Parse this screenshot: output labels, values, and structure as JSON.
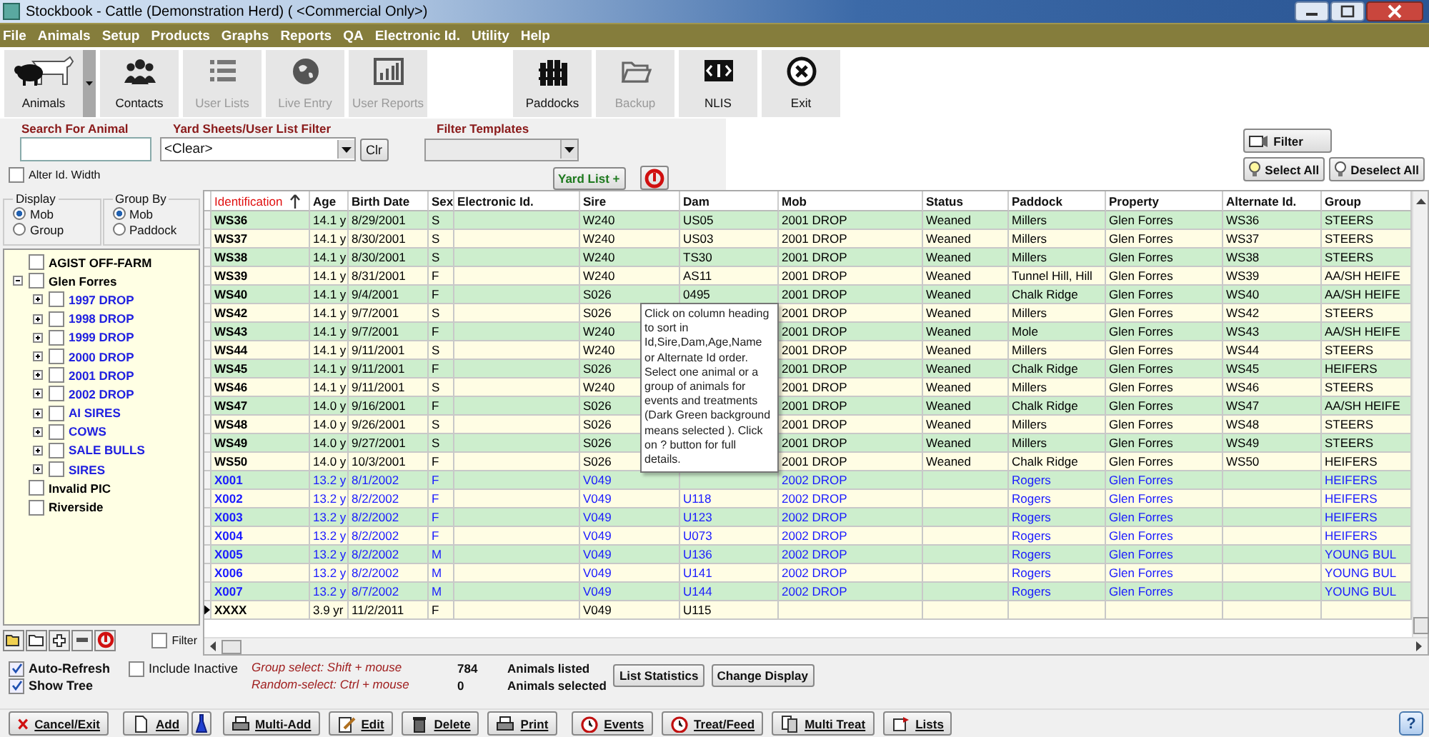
{
  "window": {
    "title": "Stockbook - Cattle (Demonstration Herd) ( <Commercial Only>)"
  },
  "menu": [
    "File",
    "Animals",
    "Setup",
    "Products",
    "Graphs",
    "Reports",
    "QA",
    "Electronic Id.",
    "Utility",
    "Help"
  ],
  "toolbar_left": [
    {
      "label": "Animals",
      "disabled": false
    },
    {
      "label": "Contacts",
      "disabled": false
    },
    {
      "label": "User Lists",
      "disabled": true
    },
    {
      "label": "Live Entry",
      "disabled": true
    },
    {
      "label": "User Reports",
      "disabled": true
    }
  ],
  "toolbar_right": [
    {
      "label": "Paddocks",
      "disabled": false
    },
    {
      "label": "Backup",
      "disabled": true
    },
    {
      "label": "NLIS",
      "disabled": false
    },
    {
      "label": "Exit",
      "disabled": false
    }
  ],
  "filters": {
    "search_label": "Search For Animal",
    "yard_label": "Yard Sheets/User List Filter",
    "yard_value": "<Clear>",
    "clear_button": "Clr",
    "templates_label": "Filter Templates",
    "alter_width": {
      "label": "Alter Id. Width",
      "checked": false
    },
    "yard_list_button": "Yard List +"
  },
  "right_buttons": {
    "filter": "Filter",
    "select_all": "Select All",
    "deselect_all": "Deselect All"
  },
  "display": {
    "title": "Display",
    "options": [
      {
        "label": "Mob",
        "selected": true
      },
      {
        "label": "Group",
        "selected": false
      }
    ]
  },
  "group_by": {
    "title": "Group By",
    "options": [
      {
        "label": "Mob",
        "selected": true
      },
      {
        "label": "Paddock",
        "selected": false
      }
    ]
  },
  "tree": [
    {
      "label": "AGIST OFF-FARM",
      "checked": false,
      "color": "#000000"
    },
    {
      "label": "Glen Forres",
      "checked": false,
      "color": "#000000",
      "expanded": true,
      "children": [
        {
          "label": "1997 DROP",
          "checked": false,
          "color": "#2020e0",
          "expanded": false
        },
        {
          "label": "1998 DROP",
          "checked": false,
          "color": "#2020e0",
          "expanded": false
        },
        {
          "label": "1999 DROP",
          "checked": false,
          "color": "#2020e0",
          "expanded": false
        },
        {
          "label": "2000 DROP",
          "checked": false,
          "color": "#2020e0",
          "expanded": false
        },
        {
          "label": "2001 DROP",
          "checked": false,
          "color": "#2020e0",
          "expanded": false
        },
        {
          "label": "2002 DROP",
          "checked": false,
          "color": "#2020e0",
          "expanded": false
        },
        {
          "label": "AI SIRES",
          "checked": false,
          "color": "#2020e0",
          "expanded": false
        },
        {
          "label": "COWS",
          "checked": false,
          "color": "#2020e0",
          "expanded": false
        },
        {
          "label": "SALE BULLS",
          "checked": false,
          "color": "#2020e0",
          "expanded": false
        },
        {
          "label": "SIRES",
          "checked": false,
          "color": "#2020e0",
          "expanded": false
        }
      ]
    },
    {
      "label": "Invalid PIC",
      "checked": false,
      "color": "#000000"
    },
    {
      "label": "Riverside",
      "checked": false,
      "color": "#000000"
    }
  ],
  "tree_filter": {
    "label": "Filter",
    "checked": false
  },
  "table": {
    "columns": [
      {
        "label": "Identification",
        "sorted": true
      },
      {
        "label": "Age",
        "sorted": false
      },
      {
        "label": "Birth Date",
        "sorted": false
      },
      {
        "label": "Sex",
        "sorted": false
      },
      {
        "label": "Electronic Id.",
        "sorted": false
      },
      {
        "label": "Sire",
        "sorted": false
      },
      {
        "label": "Dam",
        "sorted": false
      },
      {
        "label": "Mob",
        "sorted": false
      },
      {
        "label": "Status",
        "sorted": false
      },
      {
        "label": "Paddock",
        "sorted": false
      },
      {
        "label": "Property",
        "sorted": false
      },
      {
        "label": "Alternate Id.",
        "sorted": false
      },
      {
        "label": "Group",
        "sorted": false
      }
    ],
    "rows": [
      {
        "current": false,
        "color": "#000000",
        "cells": [
          "WS36",
          "14.1 y",
          "8/29/2001",
          "S",
          null,
          "W240",
          "US05",
          "2001 DROP",
          "Weaned",
          "Millers",
          "Glen Forres",
          "WS36",
          "STEERS"
        ]
      },
      {
        "current": false,
        "color": "#000000",
        "cells": [
          "WS37",
          "14.1 y",
          "8/30/2001",
          "S",
          null,
          "W240",
          "US03",
          "2001 DROP",
          "Weaned",
          "Millers",
          "Glen Forres",
          "WS37",
          "STEERS"
        ]
      },
      {
        "current": false,
        "color": "#000000",
        "cells": [
          "WS38",
          "14.1 y",
          "8/30/2001",
          "S",
          null,
          "W240",
          "TS30",
          "2001 DROP",
          "Weaned",
          "Millers",
          "Glen Forres",
          "WS38",
          "STEERS"
        ]
      },
      {
        "current": false,
        "color": "#000000",
        "cells": [
          "WS39",
          "14.1 y",
          "8/31/2001",
          "F",
          null,
          "W240",
          "AS11",
          "2001 DROP",
          "Weaned",
          "Tunnel Hill, Hill",
          "Glen Forres",
          "WS39",
          "AA/SH HEIFE"
        ]
      },
      {
        "current": false,
        "color": "#000000",
        "cells": [
          "WS40",
          "14.1 y",
          "9/4/2001",
          "F",
          null,
          "S026",
          "0495",
          "2001 DROP",
          "Weaned",
          "Chalk Ridge",
          "Glen Forres",
          "WS40",
          "AA/SH HEIFE"
        ]
      },
      {
        "current": false,
        "color": "#000000",
        "cells": [
          "WS42",
          "14.1 y",
          "9/7/2001",
          "S",
          null,
          "S026",
          null,
          "2001 DROP",
          "Weaned",
          "Millers",
          "Glen Forres",
          "WS42",
          "STEERS"
        ]
      },
      {
        "current": false,
        "color": "#000000",
        "cells": [
          "WS43",
          "14.1 y",
          "9/7/2001",
          "F",
          null,
          "W240",
          null,
          "2001 DROP",
          "Weaned",
          "Mole",
          "Glen Forres",
          "WS43",
          "AA/SH HEIFE"
        ]
      },
      {
        "current": false,
        "color": "#000000",
        "cells": [
          "WS44",
          "14.1 y",
          "9/11/2001",
          "S",
          null,
          "W240",
          null,
          "2001 DROP",
          "Weaned",
          "Millers",
          "Glen Forres",
          "WS44",
          "STEERS"
        ]
      },
      {
        "current": false,
        "color": "#000000",
        "cells": [
          "WS45",
          "14.1 y",
          "9/11/2001",
          "F",
          null,
          "S026",
          null,
          "2001 DROP",
          "Weaned",
          "Chalk Ridge",
          "Glen Forres",
          "WS45",
          "HEIFERS"
        ]
      },
      {
        "current": false,
        "color": "#000000",
        "cells": [
          "WS46",
          "14.1 y",
          "9/11/2001",
          "S",
          null,
          "W240",
          null,
          "2001 DROP",
          "Weaned",
          "Millers",
          "Glen Forres",
          "WS46",
          "STEERS"
        ]
      },
      {
        "current": false,
        "color": "#000000",
        "cells": [
          "WS47",
          "14.0 y",
          "9/16/2001",
          "F",
          null,
          "S026",
          null,
          "2001 DROP",
          "Weaned",
          "Chalk Ridge",
          "Glen Forres",
          "WS47",
          "AA/SH HEIFE"
        ]
      },
      {
        "current": false,
        "color": "#000000",
        "cells": [
          "WS48",
          "14.0 y",
          "9/26/2001",
          "S",
          null,
          "S026",
          null,
          "2001 DROP",
          "Weaned",
          "Millers",
          "Glen Forres",
          "WS48",
          "STEERS"
        ]
      },
      {
        "current": false,
        "color": "#000000",
        "cells": [
          "WS49",
          "14.0 y",
          "9/27/2001",
          "S",
          null,
          "S026",
          null,
          "2001 DROP",
          "Weaned",
          "Millers",
          "Glen Forres",
          "WS49",
          "STEERS"
        ]
      },
      {
        "current": false,
        "color": "#000000",
        "cells": [
          "WS50",
          "14.0 y",
          "10/3/2001",
          "F",
          null,
          "S026",
          null,
          "2001 DROP",
          "Weaned",
          "Chalk Ridge",
          "Glen Forres",
          "WS50",
          "HEIFERS"
        ]
      },
      {
        "current": false,
        "color": "#1a1aff",
        "cells": [
          "X001",
          "13.2 y",
          "8/1/2002",
          "F",
          null,
          "V049",
          null,
          "2002 DROP",
          null,
          "Rogers",
          "Glen Forres",
          null,
          "HEIFERS"
        ]
      },
      {
        "current": false,
        "color": "#1a1aff",
        "cells": [
          "X002",
          "13.2 y",
          "8/2/2002",
          "F",
          null,
          "V049",
          "U118",
          "2002 DROP",
          null,
          "Rogers",
          "Glen Forres",
          null,
          "HEIFERS"
        ]
      },
      {
        "current": false,
        "color": "#1a1aff",
        "cells": [
          "X003",
          "13.2 y",
          "8/2/2002",
          "F",
          null,
          "V049",
          "U123",
          "2002 DROP",
          null,
          "Rogers",
          "Glen Forres",
          null,
          "HEIFERS"
        ]
      },
      {
        "current": false,
        "color": "#1a1aff",
        "cells": [
          "X004",
          "13.2 y",
          "8/2/2002",
          "F",
          null,
          "V049",
          "U073",
          "2002 DROP",
          null,
          "Rogers",
          "Glen Forres",
          null,
          "HEIFERS"
        ]
      },
      {
        "current": false,
        "color": "#1a1aff",
        "cells": [
          "X005",
          "13.2 y",
          "8/2/2002",
          "M",
          null,
          "V049",
          "U136",
          "2002 DROP",
          null,
          "Rogers",
          "Glen Forres",
          null,
          "YOUNG BUL"
        ]
      },
      {
        "current": false,
        "color": "#1a1aff",
        "cells": [
          "X006",
          "13.2 y",
          "8/2/2002",
          "M",
          null,
          "V049",
          "U141",
          "2002 DROP",
          null,
          "Rogers",
          "Glen Forres",
          null,
          "YOUNG BUL"
        ]
      },
      {
        "current": false,
        "color": "#1a1aff",
        "cells": [
          "X007",
          "13.2 y",
          "8/7/2002",
          "M",
          null,
          "V049",
          "U144",
          "2002 DROP",
          null,
          "Rogers",
          "Glen Forres",
          null,
          "YOUNG BUL"
        ]
      },
      {
        "current": true,
        "color": "#000000",
        "cells": [
          "XXXX",
          "3.9 yr",
          "11/2/2011",
          "F",
          null,
          "V049",
          "U115",
          null,
          null,
          null,
          null,
          null,
          null
        ]
      }
    ]
  },
  "tooltip": "Click on column heading to sort in Id,Sire,Dam,Age,Name or Alternate Id order. Select one animal or a group of animals for events and treatments (Dark Green background means selected ). Click on ? button for full details.",
  "status": {
    "checks": [
      {
        "label": "Auto-Refresh",
        "checked": true
      },
      {
        "label": "Show Tree",
        "checked": true
      },
      {
        "label": "Include Inactive",
        "checked": false
      }
    ],
    "hints": [
      "Group select: Shift + mouse",
      "Random-select: Ctrl + mouse"
    ],
    "counts": [
      {
        "value": "784",
        "label": "Animals listed"
      },
      {
        "value": "0",
        "label": "Animals selected"
      }
    ],
    "buttons": [
      "List Statistics",
      "Change Display"
    ]
  },
  "bottom_buttons": [
    {
      "kind": "text",
      "label": "Cancel/Exit"
    },
    {
      "kind": "text",
      "label": "Add"
    },
    {
      "kind": "icon"
    },
    {
      "kind": "text",
      "label": "Multi-Add"
    },
    {
      "kind": "text",
      "label": "Edit"
    },
    {
      "kind": "text",
      "label": "Delete"
    },
    {
      "kind": "text",
      "label": "Print"
    },
    {
      "kind": "text",
      "label": "Events"
    },
    {
      "kind": "text",
      "label": "Treat/Feed"
    },
    {
      "kind": "text",
      "label": "Multi Treat"
    },
    {
      "kind": "text",
      "label": "Lists"
    }
  ],
  "help_button": "?"
}
